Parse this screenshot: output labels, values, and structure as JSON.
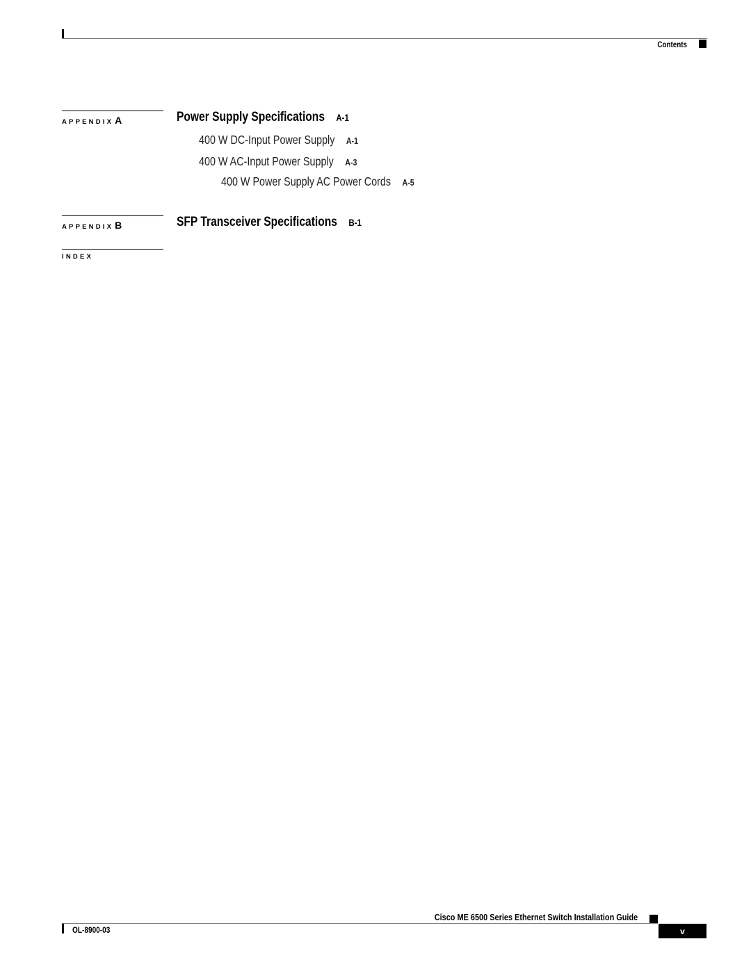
{
  "header": {
    "section": "Contents"
  },
  "toc": {
    "appendix_a": {
      "label": "APPENDIX",
      "letter": "A",
      "title": "Power Supply Specifications",
      "page": "A-1",
      "entries": [
        {
          "title": "400 W DC-Input Power Supply",
          "page": "A-1"
        },
        {
          "title": "400 W AC-Input Power Supply",
          "page": "A-3"
        },
        {
          "title": "400 W Power Supply AC Power Cords",
          "page": "A-5"
        }
      ]
    },
    "appendix_b": {
      "label": "APPENDIX",
      "letter": "B",
      "title": "SFP Transceiver Specifications",
      "page": "B-1"
    },
    "index": {
      "label": "INDEX"
    }
  },
  "footer": {
    "guide_title": "Cisco ME 6500 Series Ethernet Switch Installation Guide",
    "doc_number": "OL-8900-03",
    "page_number": "v"
  }
}
